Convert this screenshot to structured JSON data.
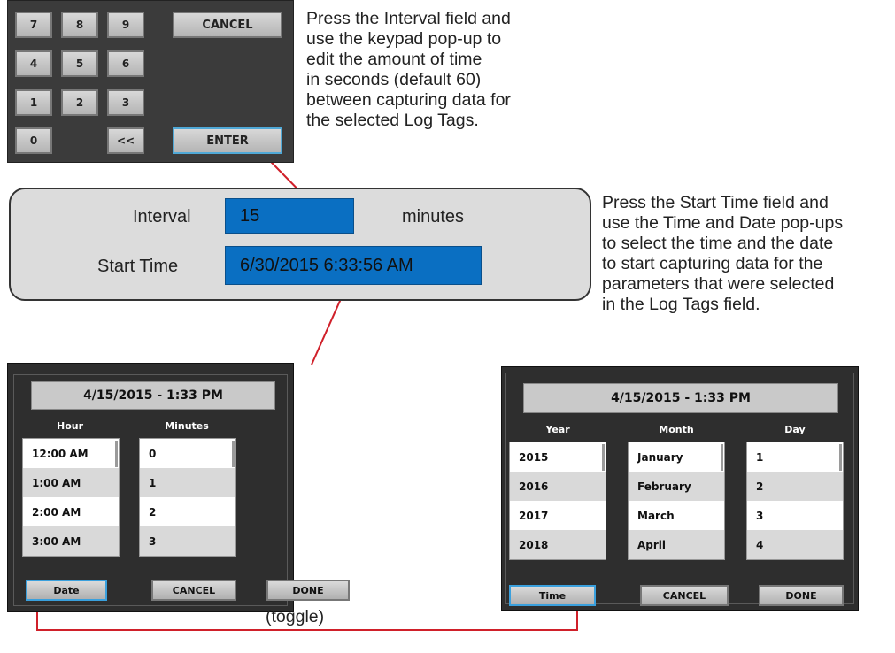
{
  "keypad": {
    "keys": [
      "7",
      "8",
      "9",
      "4",
      "5",
      "6",
      "1",
      "2",
      "3",
      "0",
      "<<"
    ],
    "cancel_label": "CANCEL",
    "enter_label": "ENTER"
  },
  "notes": {
    "interval": [
      "Press the Interval field and",
      "use the keypad pop-up to",
      "edit the amount of time",
      "in seconds (default 60)",
      "between capturing data for",
      "the selected Log Tags."
    ],
    "start_time": [
      "Press the Start Time field and",
      "use the Time and Date pop-ups",
      "to select the time and the date",
      "to start capturing data for the",
      "parameters that were selected",
      "in the Log Tags field."
    ],
    "toggle": "(toggle)"
  },
  "fields": {
    "interval_label": "Interval",
    "interval_value": "15",
    "interval_unit": "minutes",
    "start_label": "Start Time",
    "start_value": "6/30/2015 6:33:56 AM"
  },
  "time_dialog": {
    "title": "4/15/2015 - 1:33 PM",
    "hour_header": "Hour",
    "minutes_header": "Minutes",
    "hours": [
      "12:00 AM",
      "1:00 AM",
      "2:00 AM",
      "3:00 AM"
    ],
    "minutes": [
      "0",
      "1",
      "2",
      "3"
    ],
    "date_button": "Date",
    "cancel_button": "CANCEL",
    "done_button": "DONE"
  },
  "date_dialog": {
    "title": "4/15/2015 - 1:33 PM",
    "year_header": "Year",
    "month_header": "Month",
    "day_header": "Day",
    "years": [
      "2015",
      "2016",
      "2017",
      "2018"
    ],
    "months": [
      "January",
      "February",
      "March",
      "April"
    ],
    "days": [
      "1",
      "2",
      "3",
      "4"
    ],
    "time_button": "Time",
    "cancel_button": "CANCEL",
    "done_button": "DONE"
  },
  "colors": {
    "accent_blue": "#0a6fc2",
    "connector_red": "#d0202a",
    "dialog_bg": "#2e2e2e"
  }
}
